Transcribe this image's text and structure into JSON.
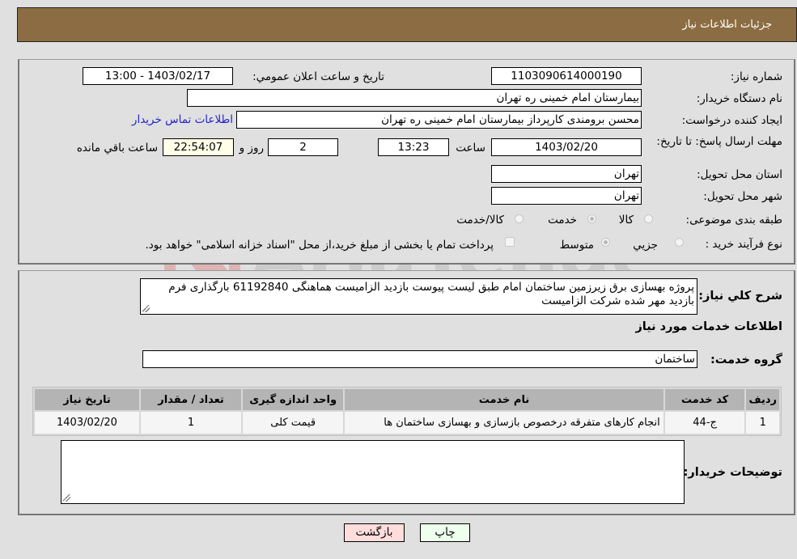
{
  "header": {
    "title": "جزئيات اطلاعات نیاز"
  },
  "form": {
    "need_number": {
      "label": "شماره نیاز:",
      "value": "1103090614000190"
    },
    "announce_datetime": {
      "label": "تاریخ و ساعت اعلان عمومي:",
      "value": "1403/02/17 - 13:00"
    },
    "buyer_org": {
      "label": "نام دستگاه خریدار:",
      "value": "بیمارستان امام خمینی ره  تهران"
    },
    "requester": {
      "label": "ایجاد کننده درخواست:",
      "value": "محسن برومندی کارپرداز بیمارستان امام خمینی ره  تهران"
    },
    "buyer_contact_link": "اطلاعات تماس خریدار",
    "deadline": {
      "label": "مهلت ارسال پاسخ: تا تاریخ:",
      "date": "1403/02/20",
      "time_label": "ساعت",
      "time": "13:23",
      "days": "2",
      "days_label": "روز و",
      "remaining": "22:54:07",
      "remaining_label": "ساعت باقي مانده"
    },
    "delivery_province": {
      "label": "استان محل تحویل:",
      "value": "تهران"
    },
    "delivery_city": {
      "label": "شهر محل تحویل:",
      "value": "تهران"
    },
    "category": {
      "label": "طبقه بندی موضوعی:",
      "options": [
        {
          "label": "کالا",
          "checked": false
        },
        {
          "label": "خدمت",
          "checked": true
        },
        {
          "label": "کالا/خدمت",
          "checked": false
        }
      ]
    },
    "purchase_type": {
      "label": "نوع فرآیند خرید :",
      "options": [
        {
          "label": "جزيي",
          "checked": false
        },
        {
          "label": "متوسط",
          "checked": true
        }
      ],
      "treasury_note": "پرداخت تمام یا بخشی از مبلغ خرید،از محل \"اسناد خزانه اسلامی\" خواهد بود.",
      "treasury_checked": false
    }
  },
  "description": {
    "label": "شرح كلي نياز:",
    "text": "پروژه بهسازی برق زیرزمین ساختمان امام طبق لیست پیوست بازدید الزامیست هماهنگی 61192840 بارگذاری فرم بازدید مهر شده شرکت الزامیست"
  },
  "services": {
    "section_title": "اطلاعات خدمات مورد نياز",
    "group_label": "گروه خدمت:",
    "group_value": "ساختمان",
    "columns": [
      "رديف",
      "کد خدمت",
      "نام خدمت",
      "واحد اندازه گیری",
      "تعداد / مقدار",
      "تاریخ نیاز"
    ],
    "rows": [
      [
        "1",
        "ج-44",
        "انجام کارهای متفرقه درخصوص بازسازی و بهسازی ساختمان ها",
        "قیمت کلی",
        "1",
        "1403/02/20"
      ]
    ]
  },
  "buyer_notes": {
    "label": "توضیحات خریدار:",
    "value": ""
  },
  "buttons": {
    "print": "چاپ",
    "back": "بازگشت"
  },
  "colors": {
    "header_bg": "#8c6d43",
    "print_bg": "#eeffee",
    "back_bg": "#ffdddd",
    "link": "#2222cc"
  }
}
